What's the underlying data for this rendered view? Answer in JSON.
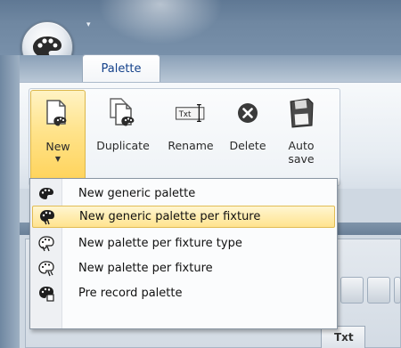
{
  "tab": {
    "label": "Palette"
  },
  "ribbon": {
    "buttons": [
      {
        "label": "New",
        "icon": "new-palette-icon"
      },
      {
        "label": "Duplicate",
        "icon": "duplicate-palette-icon"
      },
      {
        "label": "Rename",
        "icon": "rename-txt-icon",
        "icon_text": "Txt"
      },
      {
        "label": "Delete",
        "icon": "delete-x-icon"
      },
      {
        "label": "Auto",
        "label2": "save",
        "icon": "floppy-disk-icon"
      }
    ]
  },
  "menu": {
    "items": [
      {
        "label": "New generic palette",
        "icon": "generic-palette-icon",
        "highlighted": false
      },
      {
        "label": "New generic palette per fixture",
        "icon": "palette-fixture-icon",
        "highlighted": true
      },
      {
        "label": "New palette per fixture type",
        "icon": "palette-fixture-type-icon",
        "highlighted": false
      },
      {
        "label": "New palette per fixture",
        "icon": "palette-per-fixture-icon",
        "highlighted": false
      },
      {
        "label": "Pre record palette",
        "icon": "pre-record-palette-icon",
        "highlighted": false
      }
    ]
  },
  "lower": {
    "column_header": "Txt"
  },
  "colors": {
    "highlight": "#ffe38e",
    "titlebar": "#6f87a1",
    "accent_text": "#15428b"
  }
}
